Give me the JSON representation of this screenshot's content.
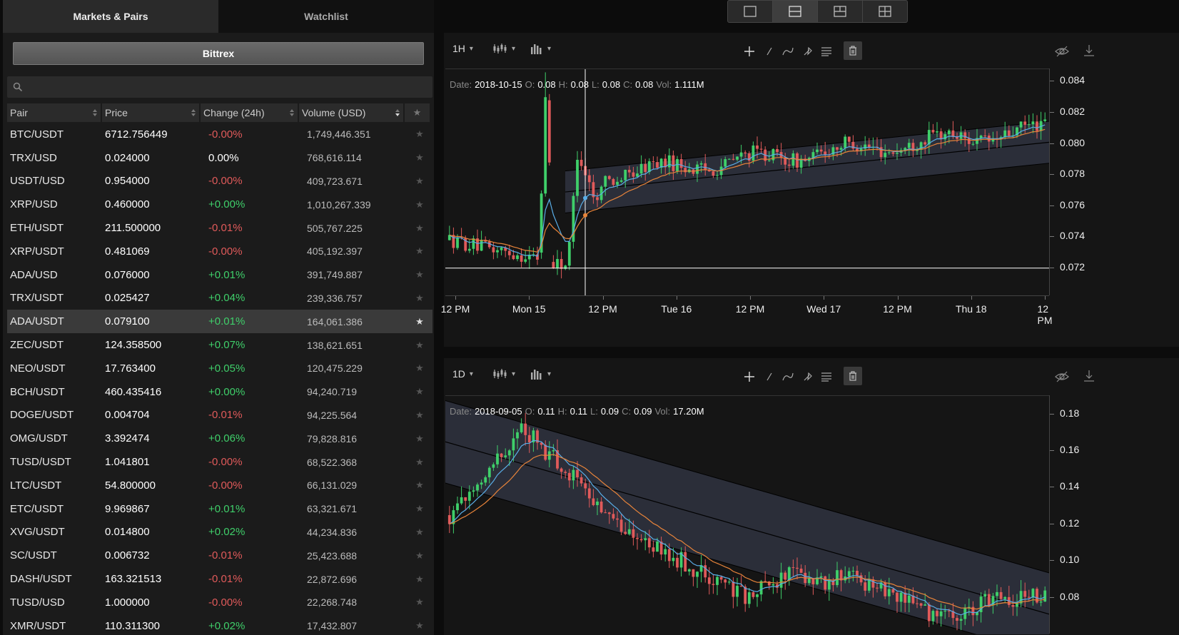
{
  "tabs": {
    "markets": "Markets & Pairs",
    "watchlist": "Watchlist"
  },
  "exchange": "Bittrex",
  "search": {
    "placeholder": ""
  },
  "columns": [
    "Pair",
    "Price",
    "Change (24h)",
    "Volume (USD)"
  ],
  "pairs": [
    {
      "pair": "BTC/USDT",
      "price": "6712.756449",
      "change": "-0.00%",
      "dir": "neg",
      "volume": "1,749,446.351",
      "fav": false
    },
    {
      "pair": "TRX/USD",
      "price": "0.024000",
      "change": "0.00%",
      "dir": "neu",
      "volume": "768,616.114",
      "fav": false
    },
    {
      "pair": "USDT/USD",
      "price": "0.954000",
      "change": "-0.00%",
      "dir": "neg",
      "volume": "409,723.671",
      "fav": false
    },
    {
      "pair": "XRP/USD",
      "price": "0.460000",
      "change": "+0.00%",
      "dir": "pos",
      "volume": "1,010,267.339",
      "fav": false
    },
    {
      "pair": "ETH/USDT",
      "price": "211.500000",
      "change": "-0.01%",
      "dir": "neg",
      "volume": "505,767.225",
      "fav": false
    },
    {
      "pair": "XRP/USDT",
      "price": "0.481069",
      "change": "-0.00%",
      "dir": "neg",
      "volume": "405,192.397",
      "fav": false
    },
    {
      "pair": "ADA/USD",
      "price": "0.076000",
      "change": "+0.01%",
      "dir": "pos",
      "volume": "391,749.887",
      "fav": false
    },
    {
      "pair": "TRX/USDT",
      "price": "0.025427",
      "change": "+0.04%",
      "dir": "pos",
      "volume": "239,336.757",
      "fav": false
    },
    {
      "pair": "ADA/USDT",
      "price": "0.079100",
      "change": "+0.01%",
      "dir": "pos",
      "volume": "164,061.386",
      "fav": true
    },
    {
      "pair": "ZEC/USDT",
      "price": "124.358500",
      "change": "+0.07%",
      "dir": "pos",
      "volume": "138,621.651",
      "fav": false
    },
    {
      "pair": "NEO/USDT",
      "price": "17.763400",
      "change": "+0.05%",
      "dir": "pos",
      "volume": "120,475.229",
      "fav": false
    },
    {
      "pair": "BCH/USDT",
      "price": "460.435416",
      "change": "+0.00%",
      "dir": "pos",
      "volume": "94,240.719",
      "fav": false
    },
    {
      "pair": "DOGE/USDT",
      "price": "0.004704",
      "change": "-0.01%",
      "dir": "neg",
      "volume": "94,225.564",
      "fav": false
    },
    {
      "pair": "OMG/USDT",
      "price": "3.392474",
      "change": "+0.06%",
      "dir": "pos",
      "volume": "79,828.816",
      "fav": false
    },
    {
      "pair": "TUSD/USDT",
      "price": "1.041801",
      "change": "-0.00%",
      "dir": "neg",
      "volume": "68,522.368",
      "fav": false
    },
    {
      "pair": "LTC/USDT",
      "price": "54.800000",
      "change": "-0.00%",
      "dir": "neg",
      "volume": "66,131.029",
      "fav": false
    },
    {
      "pair": "ETC/USDT",
      "price": "9.969867",
      "change": "+0.01%",
      "dir": "pos",
      "volume": "63,321.671",
      "fav": false
    },
    {
      "pair": "XVG/USDT",
      "price": "0.014800",
      "change": "+0.02%",
      "dir": "pos",
      "volume": "44,234.836",
      "fav": false
    },
    {
      "pair": "SC/USDT",
      "price": "0.006732",
      "change": "-0.01%",
      "dir": "neg",
      "volume": "25,423.688",
      "fav": false
    },
    {
      "pair": "DASH/USDT",
      "price": "163.321513",
      "change": "-0.01%",
      "dir": "neg",
      "volume": "22,872.696",
      "fav": false
    },
    {
      "pair": "TUSD/USD",
      "price": "1.000000",
      "change": "-0.00%",
      "dir": "neg",
      "volume": "22,268.748",
      "fav": false
    },
    {
      "pair": "XMR/USDT",
      "price": "110.311300",
      "change": "+0.02%",
      "dir": "pos",
      "volume": "17,432.807",
      "fav": false
    }
  ],
  "layout_options": [
    "single",
    "horizontal-split",
    "vertical-split",
    "quad"
  ],
  "layout_selected": "horizontal-split",
  "colors": {
    "up": "#3fcf6a",
    "down": "#e05a5a",
    "ema_fast": "#5aaee8",
    "ema_slow": "#e8843a",
    "channel": "#2f3340"
  },
  "charts": [
    {
      "interval": "1H",
      "ohlc": {
        "date_label": "Date:",
        "date": "2018-10-15",
        "o_label": "O:",
        "o": "0.08",
        "h_label": "H:",
        "h": "0.08",
        "l_label": "L:",
        "l": "0.08",
        "c_label": "C:",
        "c": "0.08",
        "vol_label": "Vol:",
        "vol": "1.111M"
      },
      "y_ticks": [
        "0.084",
        "0.082",
        "0.080",
        "0.078",
        "0.076",
        "0.074",
        "0.072"
      ],
      "x_ticks": [
        "12 PM",
        "Mon 15",
        "12 PM",
        "Tue 16",
        "12 PM",
        "Wed 17",
        "12 PM",
        "Thu 18",
        "12 PM"
      ],
      "ylim": [
        0.0702,
        0.0848
      ],
      "crosshair": {
        "price": 0.072
      },
      "channel": {
        "start": 0.0769,
        "end": 0.0801,
        "width": 0.0027
      }
    },
    {
      "interval": "1D",
      "ohlc": {
        "date_label": "Date:",
        "date": "2018-09-05",
        "o_label": "O:",
        "o": "0.11",
        "h_label": "H:",
        "h": "0.11",
        "l_label": "L:",
        "l": "0.09",
        "c_label": "C:",
        "c": "0.09",
        "vol_label": "Vol:",
        "vol": "17.20M"
      },
      "y_ticks": [
        "0.18",
        "0.16",
        "0.14",
        "0.12",
        "0.10",
        "0.08"
      ],
      "x_ticks": [],
      "ylim": [
        0.06,
        0.19
      ],
      "channel": {
        "start": 0.165,
        "end": 0.071,
        "width": 0.045
      }
    }
  ]
}
